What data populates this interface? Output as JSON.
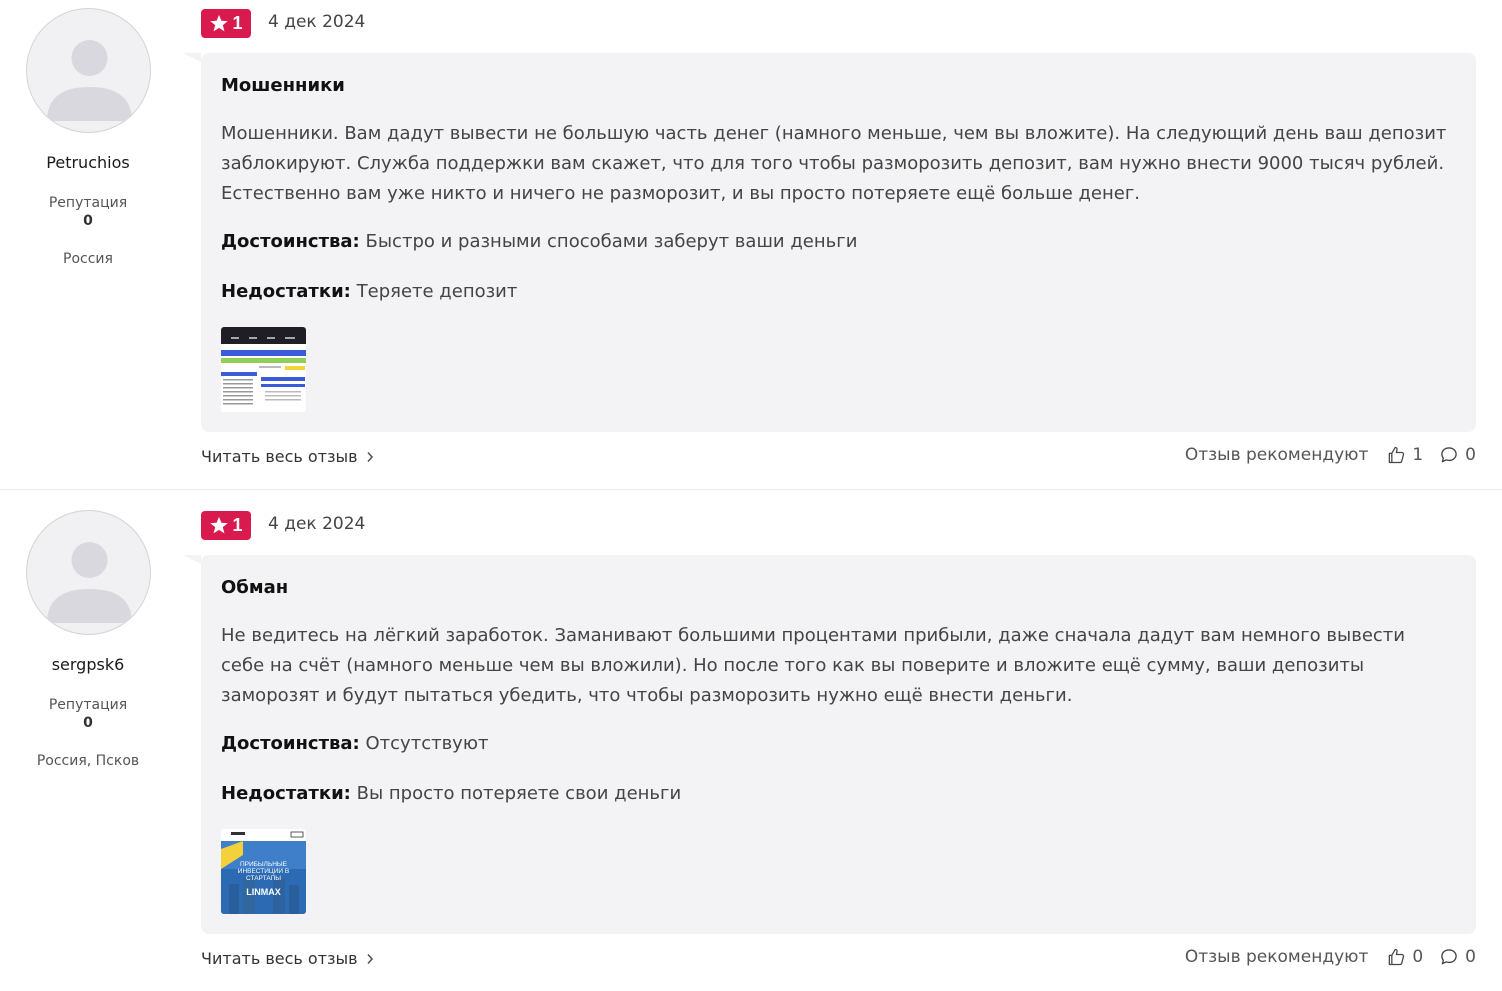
{
  "reviews": [
    {
      "author": {
        "name": "Petruchios",
        "reputation_label": "Репутация",
        "reputation_value": "0",
        "location": "Россия"
      },
      "rating": "1",
      "date": "4 дек 2024",
      "title": "Мошенники",
      "text": "Мошенники. Вам дадут вывести не большую часть денег (намного меньше, чем вы вложите). На следующий день ваш депозит заблокируют. Служба поддержки вам скажет, что для того чтобы разморозить депозит, вам нужно внести 9000 тысяч рублей. Естественно вам уже никто и ничего не разморозит, и вы просто потеряете ещё больше денег.",
      "pros_label": "Достоинства:",
      "pros": "Быстро и разными способами заберут ваши деньги",
      "cons_label": "Недостатки:",
      "cons": "Теряете депозит",
      "read_more": "Читать весь отзыв",
      "recommend_label": "Отзыв рекомендуют",
      "likes": "1",
      "comments": "0"
    },
    {
      "author": {
        "name": "sergpsk6",
        "reputation_label": "Репутация",
        "reputation_value": "0",
        "location": "Россия, Псков"
      },
      "rating": "1",
      "date": "4 дек 2024",
      "title": "Обман",
      "text": "Не ведитесь на лёгкий заработок. Заманивают большими процентами прибыли, даже сначала дадут вам немного вывести себе на счёт (намного меньше чем вы вложили). Но после того как вы поверите и вложите ещё сумму, ваши депозиты заморозят и будут пытаться убедить, что чтобы разморозить нужно ещё внести деньги.",
      "pros_label": "Достоинства:",
      "pros": "Отсутствуют",
      "cons_label": "Недостатки:",
      "cons": "Вы просто потеряете свои деньги",
      "read_more": "Читать весь отзыв",
      "recommend_label": "Отзыв рекомендуют",
      "likes": "0",
      "comments": "0",
      "thumb_banner": {
        "line1": "ПРИБЫЛЬНЫЕ",
        "line2": "ИНВЕСТИЦИИ В",
        "line3": "СТАРТАПЫ",
        "brand": "LINMAX"
      }
    }
  ],
  "colors": {
    "badge": "#d81a4f",
    "card_bg": "#f3f3f5",
    "avatar_bg": "#f1f1f4",
    "avatar_figure": "#d8d8de"
  },
  "icons": {
    "rating": "star-icon",
    "likes": "thumbs-up-icon",
    "comments": "comment-icon",
    "read_more": "chevron-right-icon",
    "avatar": "user-placeholder-icon"
  }
}
